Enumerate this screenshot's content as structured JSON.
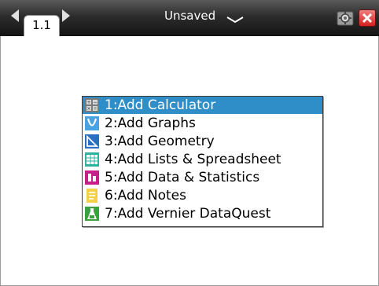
{
  "header": {
    "page_tab": "1.1",
    "doc_title": "Unsaved"
  },
  "add_menu": {
    "items": [
      {
        "label": "1:Add Calculator",
        "icon": "calculator-icon",
        "selected": true
      },
      {
        "label": "2:Add Graphs",
        "icon": "graphs-icon",
        "selected": false
      },
      {
        "label": "3:Add Geometry",
        "icon": "geometry-icon",
        "selected": false
      },
      {
        "label": "4:Add Lists & Spreadsheet",
        "icon": "spreadsheet-icon",
        "selected": false
      },
      {
        "label": "5:Add Data & Statistics",
        "icon": "data-statistics-icon",
        "selected": false
      },
      {
        "label": "6:Add Notes",
        "icon": "notes-icon",
        "selected": false
      },
      {
        "label": "7:Add Vernier DataQuest",
        "icon": "vernier-dataquest-icon",
        "selected": false
      }
    ]
  },
  "colors": {
    "selection": "#2f8ec7",
    "titlebar": "#1e1e1e"
  }
}
